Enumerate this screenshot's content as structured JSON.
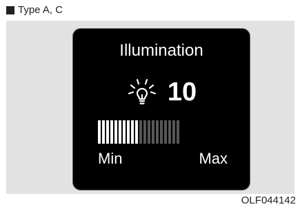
{
  "type_label": "Type A, C",
  "display": {
    "title": "Illumination",
    "icon": "illumination-lamp-icon",
    "value": "10",
    "level": {
      "current": 10,
      "total": 20
    },
    "min_label": "Min",
    "max_label": "Max"
  },
  "figure_code": "OLF044142",
  "colors": {
    "screen_bg": "#000000",
    "segment_on": "#ffffff",
    "segment_off": "#575757",
    "panel_bg": "#e2e2e3"
  }
}
